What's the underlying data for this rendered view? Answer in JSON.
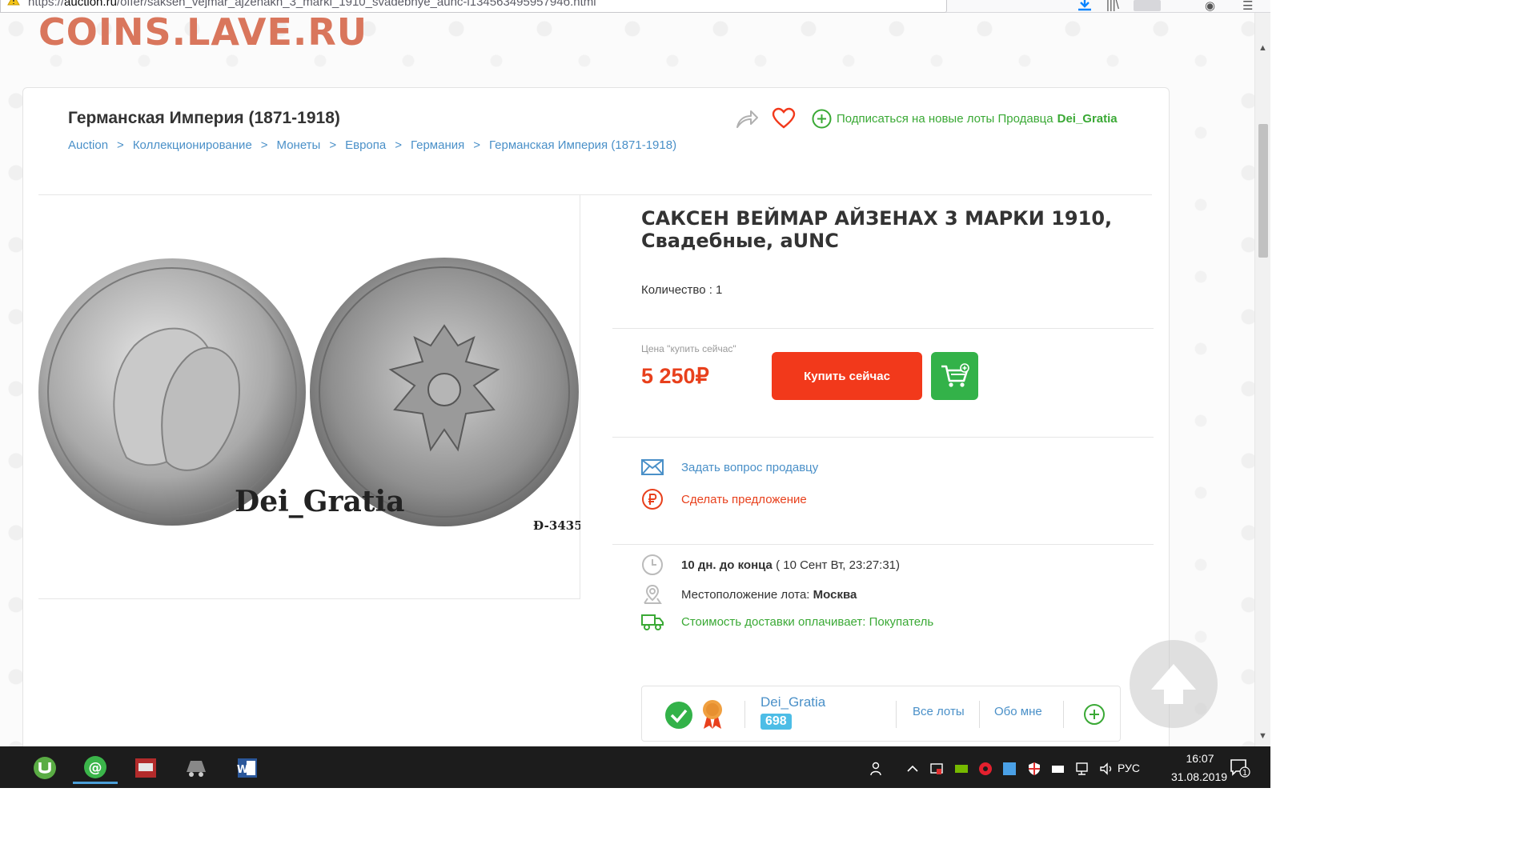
{
  "browser": {
    "url_prefix": "https://",
    "url_domain": "auction.ru",
    "url_path": "/offer/saksen_vejmar_ajzenakh_3_marki_1910_svadebnye_aunc-i13456349595794б.html"
  },
  "watermark": "COINS.LAVE.RU",
  "category": {
    "title": "Германская Империя (1871-1918)",
    "breadcrumbs": [
      "Auction",
      "Коллекционирование",
      "Монеты",
      "Европа",
      "Германия",
      "Германская Империя (1871-1918)"
    ],
    "separator": ">"
  },
  "subscribe": {
    "label": "Подписаться на новые лоты Продавца",
    "seller": "Dei_Gratia"
  },
  "coin_image": {
    "stamp": "Dei_Gratia",
    "code": "Ð-3435"
  },
  "lot": {
    "title": "САКСЕН ВЕЙМАР АЙЗЕНАХ 3 МАРКИ 1910, Свадебные, aUNC",
    "quantity_label": "Количество : 1",
    "price_label": "Цена \"купить сейчас\"",
    "price": "5 250₽",
    "buy_label": "Купить сейчас"
  },
  "actions": {
    "ask_seller": "Задать вопрос продавцу",
    "make_offer": "Сделать предложение"
  },
  "info": {
    "time_left": "10 дн. до конца",
    "end_date": "( 10 Сент Вт, 23:27:31)",
    "location_label": "Местоположение лота:",
    "location_value": "Москва",
    "shipping": "Стоимость доставки оплачивает: Покупатель"
  },
  "seller": {
    "name": "Dei_Gratia",
    "rating": "698",
    "all_lots": "Все лоты",
    "about": "Обо мне"
  },
  "taskbar": {
    "language": "РУС",
    "time": "16:07",
    "date": "31.08.2019",
    "notification_count": "1"
  },
  "colors": {
    "accent_red": "#f2391b",
    "accent_green": "#33b249",
    "link_blue": "#4a90c8"
  }
}
